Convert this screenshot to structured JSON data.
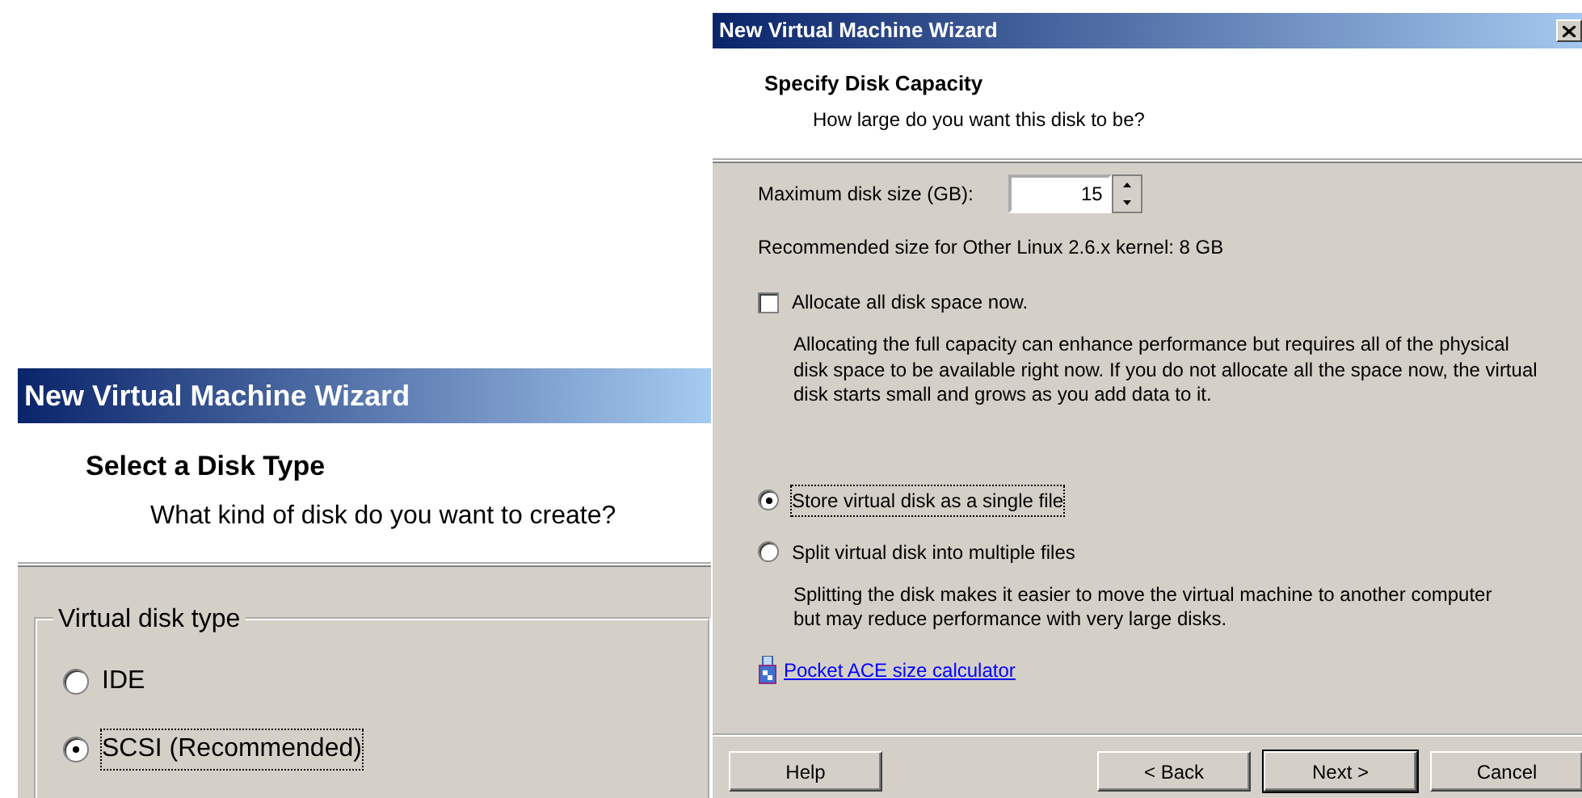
{
  "back_window": {
    "title": "New Virtual Machine Wizard",
    "heading": "Select a Disk Type",
    "subheading": "What kind of disk do you want to create?",
    "group": {
      "legend": "Virtual disk type",
      "options": [
        {
          "label": "IDE",
          "selected": false,
          "focused": false
        },
        {
          "label": "SCSI (Recommended)",
          "selected": true,
          "focused": true
        }
      ]
    }
  },
  "front_window": {
    "title": "New Virtual Machine Wizard",
    "heading": "Specify Disk Capacity",
    "subheading": "How large do you want this disk to be?",
    "disk_size": {
      "label": "Maximum disk size (GB):",
      "value": "15"
    },
    "recommendation": "Recommended size for Other Linux 2.6.x kernel: 8 GB",
    "allocate": {
      "label": "Allocate all disk space now.",
      "checked": false,
      "note": "Allocating the full capacity can enhance performance but requires all of the physical disk space to be available right now. If you do not allocate all the space now, the virtual disk starts small and grows as you add data to it."
    },
    "storage_options": [
      {
        "label": "Store virtual disk as a single file",
        "selected": true,
        "focused": true
      },
      {
        "label": "Split virtual disk into multiple files",
        "selected": false,
        "focused": false,
        "note": "Splitting the disk makes it easier to move the virtual machine to another computer but may reduce performance with very large disks."
      }
    ],
    "link": "Pocket ACE size calculator",
    "buttons": [
      {
        "label": "Help",
        "default": false,
        "kind": "left"
      },
      {
        "label": "< Back",
        "default": false,
        "kind": "right"
      },
      {
        "label": "Next >",
        "default": true,
        "kind": "right"
      },
      {
        "label": "Cancel",
        "default": false,
        "kind": "right"
      }
    ]
  }
}
